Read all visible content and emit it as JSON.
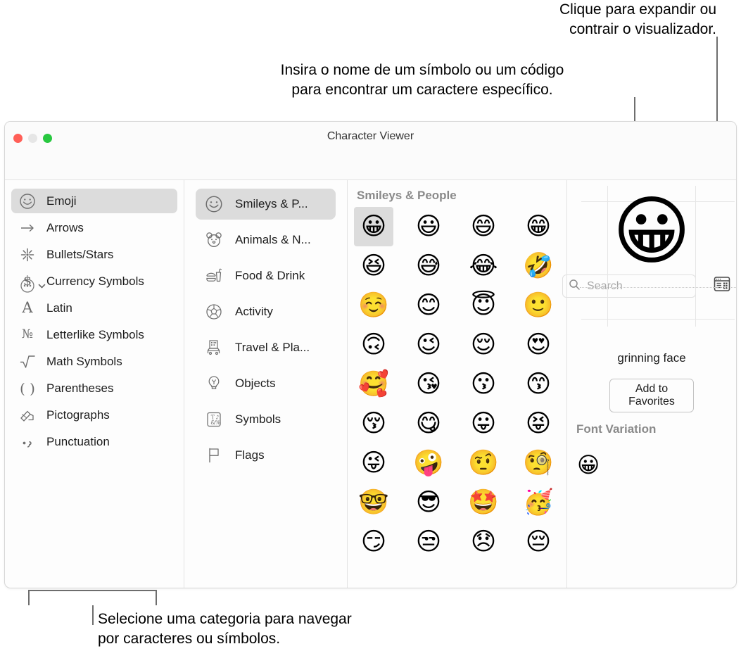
{
  "annotations": {
    "expand": "Clique para expandir ou\ncontrair o visualizador.",
    "search": "Insira o nome de um símbolo ou um código\npara encontrar um caractere específico.",
    "categories": "Selecione uma categoria para navegar\npor caracteres ou símbolos."
  },
  "window": {
    "title": "Character Viewer",
    "toolbar": {
      "actions_menu_icon": "circle-ellipsis-icon",
      "actions_menu_chevron": "chevron-down-icon",
      "expand_button_icon": "expand-viewer-icon"
    },
    "search": {
      "placeholder": "Search",
      "value": "",
      "icon": "search-icon"
    }
  },
  "sidebar": {
    "items": [
      {
        "label": "Emoji",
        "icon": "smiley-face-icon",
        "selected": true
      },
      {
        "label": "Arrows",
        "icon": "right-arrow-icon",
        "selected": false
      },
      {
        "label": "Bullets/Stars",
        "icon": "sparkle-star-icon",
        "selected": false
      },
      {
        "label": "Currency Symbols",
        "icon": "dollar-sign-icon",
        "selected": false
      },
      {
        "label": "Latin",
        "icon": "letter-a-icon",
        "selected": false
      },
      {
        "label": "Letterlike Symbols",
        "icon": "numero-sign-icon",
        "selected": false
      },
      {
        "label": "Math Symbols",
        "icon": "square-root-icon",
        "selected": false
      },
      {
        "label": "Parentheses",
        "icon": "parentheses-icon",
        "selected": false
      },
      {
        "label": "Pictographs",
        "icon": "pictograph-hand-icon",
        "selected": false
      },
      {
        "label": "Punctuation",
        "icon": "punctuation-icon",
        "selected": false
      }
    ]
  },
  "subcategories": {
    "items": [
      {
        "label": "Smileys & P...",
        "icon": "smiley-face-icon",
        "selected": true
      },
      {
        "label": "Animals & N...",
        "icon": "bear-face-icon",
        "selected": false
      },
      {
        "label": "Food & Drink",
        "icon": "burger-drink-icon",
        "selected": false
      },
      {
        "label": "Activity",
        "icon": "soccer-ball-icon",
        "selected": false
      },
      {
        "label": "Travel & Pla...",
        "icon": "city-car-icon",
        "selected": false
      },
      {
        "label": "Objects",
        "icon": "lightbulb-icon",
        "selected": false
      },
      {
        "label": "Symbols",
        "icon": "symbols-box-icon",
        "selected": false
      },
      {
        "label": "Flags",
        "icon": "flag-icon",
        "selected": false
      }
    ]
  },
  "grid": {
    "title": "Smileys & People",
    "selected_index": 0,
    "characters": [
      "😀",
      "😃",
      "😄",
      "😁",
      "😆",
      "😅",
      "😂",
      "🤣",
      "☺️",
      "😊",
      "😇",
      "🙂",
      "🙃",
      "😉",
      "😌",
      "😍",
      "🥰",
      "😘",
      "😗",
      "😙",
      "😚",
      "😋",
      "😛",
      "😝",
      "😜",
      "🤪",
      "🤨",
      "🧐",
      "🤓",
      "😎",
      "🤩",
      "🥳",
      "😏",
      "😒",
      "😞",
      "😔"
    ]
  },
  "preview": {
    "character": "😀",
    "name": "grinning face",
    "favorites_button": "Add to Favorites",
    "font_variation_title": "Font Variation",
    "font_variations": [
      "😀"
    ]
  }
}
